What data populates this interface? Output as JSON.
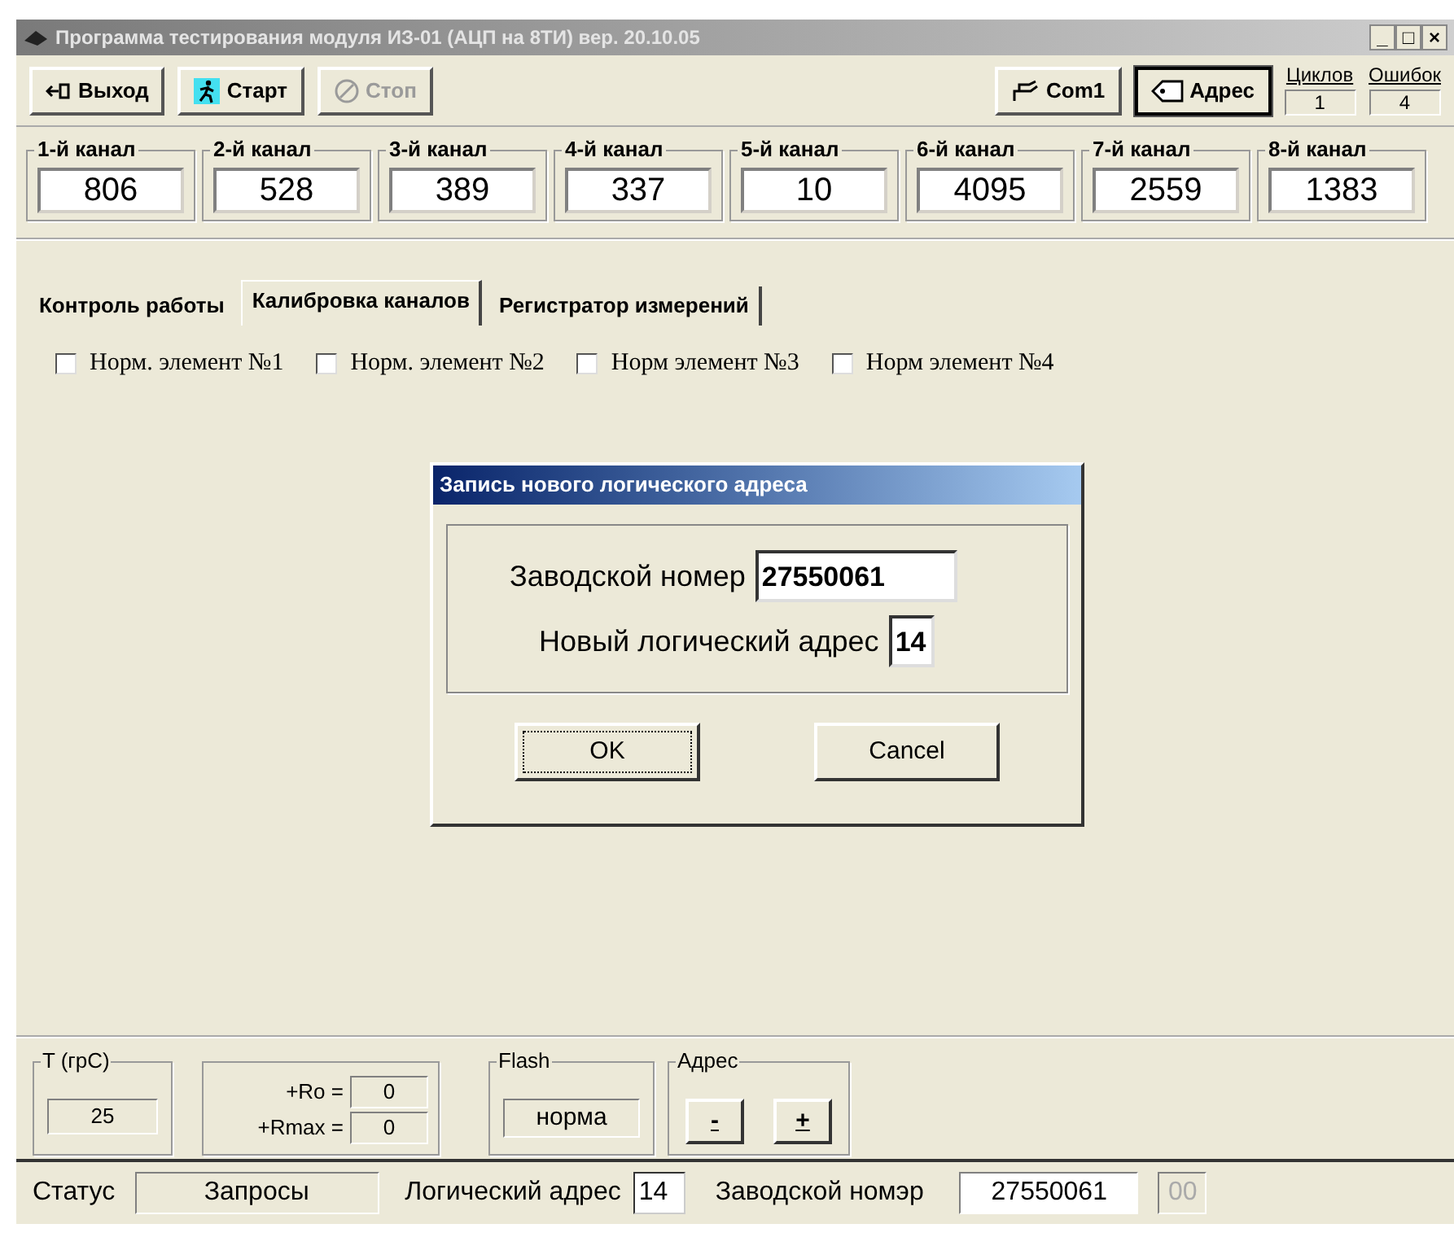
{
  "window": {
    "title": "Программа тестирования модуля ИЗ-01 (АЦП на 8ТИ) вер. 20.10.05",
    "controls": [
      "_",
      "□",
      "×"
    ]
  },
  "toolbar": {
    "buttons": [
      {
        "label": "Выход",
        "kind": "exit",
        "disabled": false
      },
      {
        "label": "Старт",
        "kind": "run",
        "disabled": false
      },
      {
        "label": "Стоп",
        "kind": "stop",
        "disabled": true
      }
    ],
    "right_buttons": [
      {
        "label": "Com1",
        "kind": "port",
        "pressed": false
      },
      {
        "label": "Адрес",
        "kind": "tag",
        "pressed": true
      }
    ],
    "counters": [
      {
        "label": "Циклов",
        "value": "1"
      },
      {
        "label": "Ошибок",
        "value": "4"
      }
    ]
  },
  "channels": [
    {
      "label": "1-й канал",
      "value": "806"
    },
    {
      "label": "2-й канал",
      "value": "528"
    },
    {
      "label": "3-й канал",
      "value": "389"
    },
    {
      "label": "4-й канал",
      "value": "337"
    },
    {
      "label": "5-й канал",
      "value": "10"
    },
    {
      "label": "6-й канал",
      "value": "4095"
    },
    {
      "label": "7-й канал",
      "value": "2559"
    },
    {
      "label": "8-й канал",
      "value": "1383"
    }
  ],
  "tabs": [
    {
      "label": "Контроль работы",
      "selected": false
    },
    {
      "label": "Калибровка каналов",
      "selected": true
    },
    {
      "label": "Регистратор измерений",
      "selected": false
    }
  ],
  "checkboxes": [
    {
      "label": "Норм. элемент №1",
      "checked": false
    },
    {
      "label": "Норм. элемент №2",
      "checked": false
    },
    {
      "label": "Норм элемент №3",
      "checked": false
    },
    {
      "label": "Норм элемент №4",
      "checked": false
    }
  ],
  "dialog": {
    "title": "Запись нового логического адреса",
    "fields": [
      {
        "label": "Заводской номер",
        "value": "27550061"
      },
      {
        "label": "Новый логический адрес",
        "value": "14"
      }
    ],
    "buttons": [
      "OK",
      "Cancel"
    ]
  },
  "bottom": {
    "temperature": {
      "label": "T (грС)",
      "value": "25"
    },
    "resistance": [
      {
        "label": "+Ro =",
        "value": "0"
      },
      {
        "label": "+Rmax =",
        "value": "0"
      }
    ],
    "flash": {
      "label": "Flash",
      "value": "норма"
    },
    "address": {
      "label": "Адрес",
      "buttons": [
        "-",
        "+"
      ]
    }
  },
  "status_bar": {
    "status_label": "Статус",
    "status": "Запросы",
    "address_label": "Логический адрес",
    "address": "14",
    "serial_label": "Заводской номэр",
    "serial": "27550061",
    "extra": "00"
  }
}
